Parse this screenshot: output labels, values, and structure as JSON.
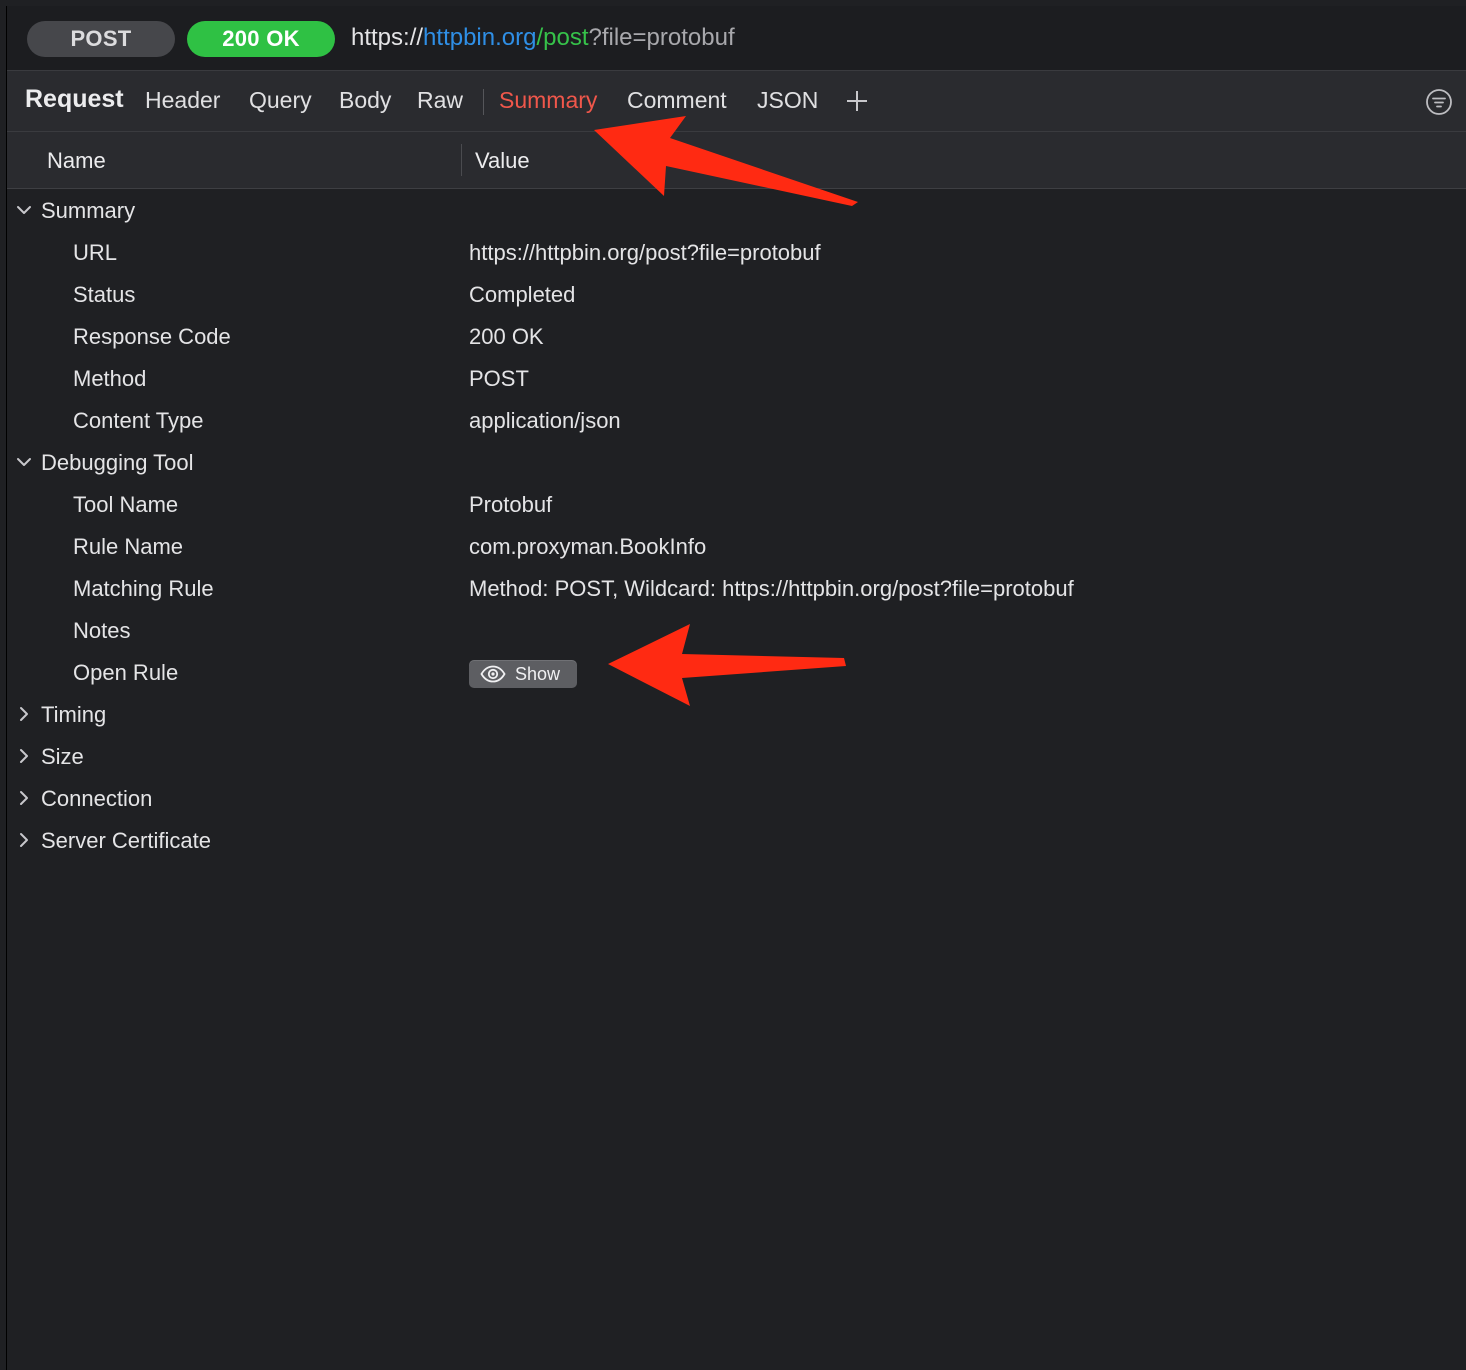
{
  "request": {
    "method": "POST",
    "status": "200 OK",
    "url": {
      "scheme": "https://",
      "host": "httpbin.org",
      "path": "/post",
      "query": "?file=protobuf"
    }
  },
  "tabs": {
    "title": "Request",
    "items": [
      {
        "label": "Header"
      },
      {
        "label": "Query"
      },
      {
        "label": "Body"
      },
      {
        "label": "Raw"
      },
      {
        "label": "Summary"
      },
      {
        "label": "Comment"
      },
      {
        "label": "JSON"
      }
    ],
    "active": "Summary"
  },
  "columns": {
    "name": "Name",
    "value": "Value"
  },
  "groups": {
    "summary": {
      "label": "Summary",
      "expanded": true,
      "rows": [
        {
          "name": "URL",
          "value": "https://httpbin.org/post?file=protobuf"
        },
        {
          "name": "Status",
          "value": "Completed"
        },
        {
          "name": "Response Code",
          "value": "200 OK"
        },
        {
          "name": "Method",
          "value": "POST"
        },
        {
          "name": "Content Type",
          "value": "application/json"
        }
      ]
    },
    "debugging": {
      "label": "Debugging Tool",
      "expanded": true,
      "rows": [
        {
          "name": "Tool Name",
          "value": "Protobuf"
        },
        {
          "name": "Rule Name",
          "value": "com.proxyman.BookInfo"
        },
        {
          "name": "Matching Rule",
          "value": "Method: POST, Wildcard: https://httpbin.org/post?file=protobuf"
        },
        {
          "name": "Notes",
          "value": ""
        },
        {
          "name": "Open Rule",
          "button": "Show"
        }
      ]
    },
    "collapsed": [
      {
        "label": "Timing"
      },
      {
        "label": "Size"
      },
      {
        "label": "Connection"
      },
      {
        "label": "Server Certificate"
      }
    ]
  },
  "colors": {
    "accent_tab": "#f0574b",
    "status_green": "#2fc144",
    "url_host": "#2f8fe6",
    "url_path": "#36c24a",
    "annotation_arrow": "#ff2a12"
  },
  "icons": {
    "add_tab": "plus-icon",
    "filter": "filter-circle-icon",
    "show_button": "eye-icon"
  }
}
